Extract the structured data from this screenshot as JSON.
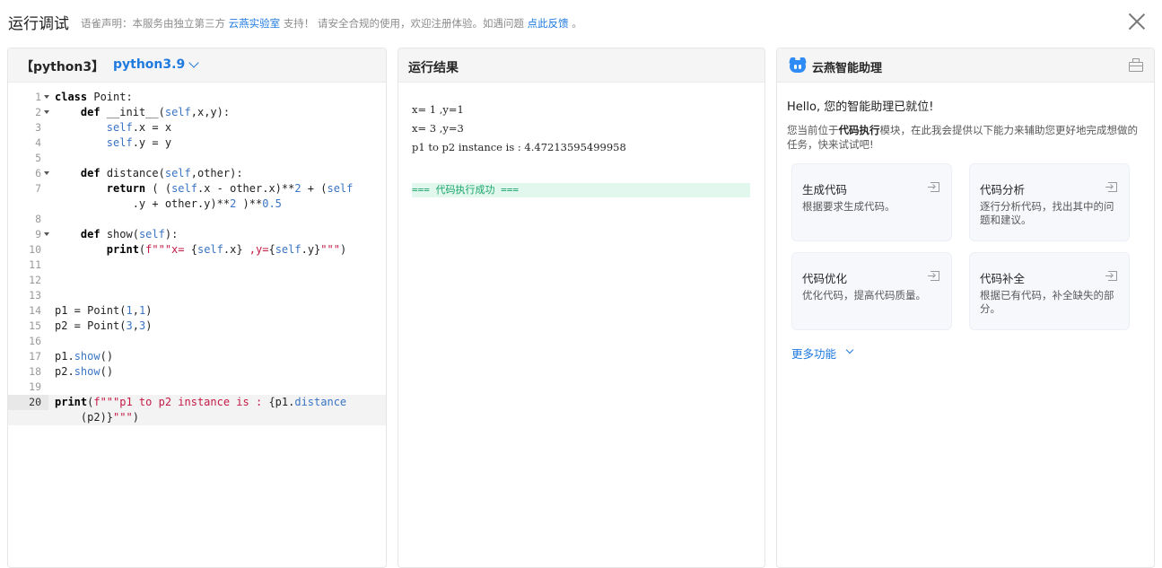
{
  "header": {
    "title": "运行调试",
    "notice_prefix": "语雀声明：本服务由独立第三方",
    "notice_link": "云燕实验室",
    "notice_middle": "支持！ 请安全合规的使用，欢迎注册体验。如遇问题",
    "notice_feedback": "点此反馈",
    "notice_suffix": "。"
  },
  "editor": {
    "language_tag": "【python3】",
    "version": "python3.9",
    "lines": [
      {
        "n": "1",
        "fold": true
      },
      {
        "n": "2",
        "fold": true
      },
      {
        "n": "3"
      },
      {
        "n": "4"
      },
      {
        "n": "5"
      },
      {
        "n": "6",
        "fold": true
      },
      {
        "n": "7"
      },
      {
        "n": ""
      },
      {
        "n": "8"
      },
      {
        "n": "9",
        "fold": true
      },
      {
        "n": "10"
      },
      {
        "n": "11"
      },
      {
        "n": "12"
      },
      {
        "n": "13"
      },
      {
        "n": "14"
      },
      {
        "n": "15"
      },
      {
        "n": "16"
      },
      {
        "n": "17"
      },
      {
        "n": "18"
      },
      {
        "n": "19"
      },
      {
        "n": "20"
      },
      {
        "n": ""
      }
    ]
  },
  "result": {
    "title": "运行结果",
    "output": [
      "x= 1 ,y=1",
      "x= 3 ,y=3",
      "p1 to p2 instance is : 4.47213595499958"
    ],
    "success": "=== 代码执行成功 ==="
  },
  "assistant": {
    "title": "云燕智能助理",
    "hello": "Hello, 您的智能助理已就位!",
    "intro_prefix": "您当前位于",
    "intro_module": "代码执行",
    "intro_suffix": "模块，在此我会提供以下能力来辅助您更好地完成想做的任务，快来试试吧!",
    "cards": [
      {
        "title": "生成代码",
        "desc": "根据要求生成代码。"
      },
      {
        "title": "代码分析",
        "desc": "逐行分析代码，找出其中的问题和建议。"
      },
      {
        "title": "代码优化",
        "desc": "优化代码，提高代码质量。"
      },
      {
        "title": "代码补全",
        "desc": "根据已有代码，补全缺失的部分。"
      }
    ],
    "more": "更多功能"
  },
  "colors": {
    "accent": "#1f7ae0",
    "success_bg": "#e2f7ee",
    "success_text": "#1aa56a",
    "string": "#c41a46",
    "builtin": "#3a74c4"
  }
}
